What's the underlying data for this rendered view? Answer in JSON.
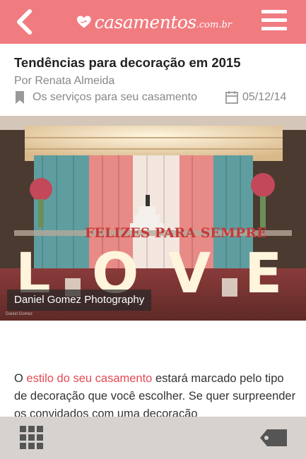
{
  "header": {
    "logo_text": "casamentos",
    "logo_suffix": ".com.br",
    "colors": {
      "brand": "#f07c80",
      "accent": "#e54a55"
    }
  },
  "article": {
    "title": "Tendências para decoração em 2015",
    "author": "Por Renata Almeida",
    "category": "Os serviços para seu casamento",
    "date": "05/12/14",
    "photo_caption": "Daniel Gomez Photography",
    "photo_credit": "Daniel Gomez",
    "photo_banner": "FELIZES PARA SEMPRE",
    "photo_letters": [
      "L",
      "O",
      "V",
      "E"
    ],
    "body_intro": "O ",
    "body_highlight": "estilo do seu casamento",
    "body_rest": " estará marcado pelo tipo de decoração que você escolher. Se quer surpreender os convidados com uma decoração"
  },
  "icons": {
    "back": "back-chevron-icon",
    "menu": "hamburger-menu-icon",
    "category": "bookmark-icon",
    "date": "calendar-icon",
    "grid": "grid-icon",
    "tag": "tag-icon"
  }
}
